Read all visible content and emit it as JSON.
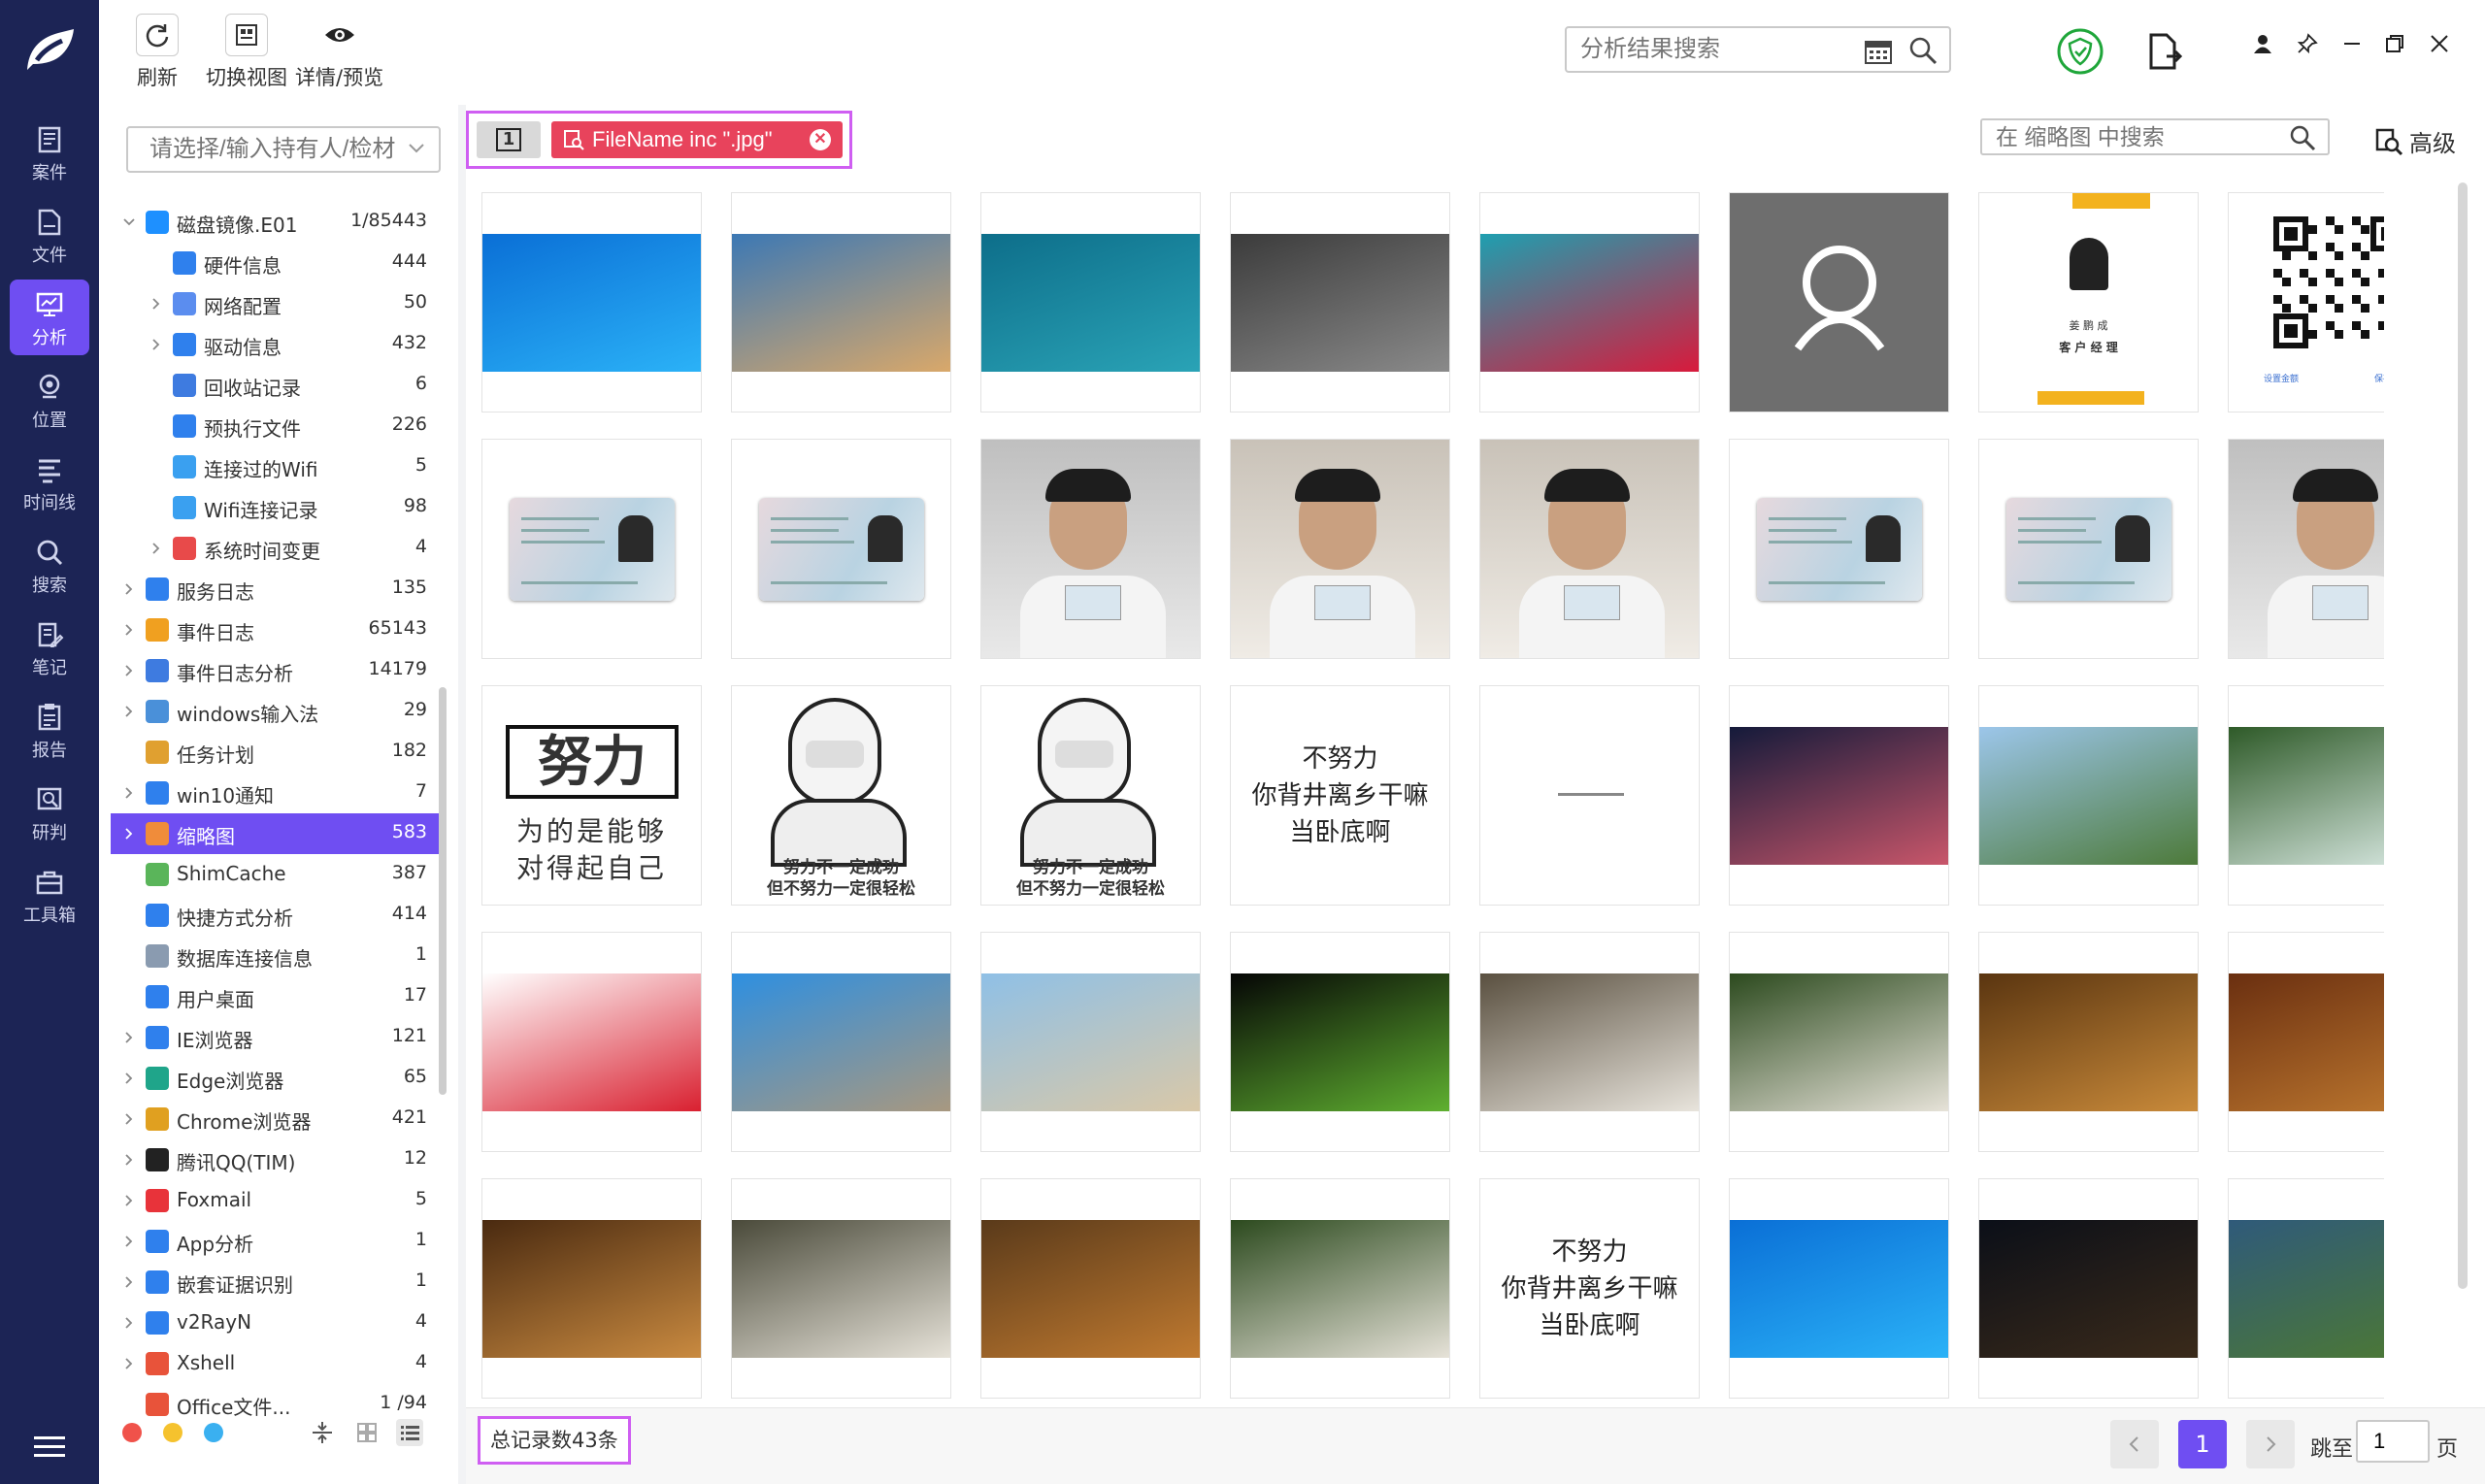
{
  "nav": {
    "items": [
      {
        "label": "案件",
        "icon": "case-icon"
      },
      {
        "label": "文件",
        "icon": "file-icon"
      },
      {
        "label": "分析",
        "icon": "analysis-icon",
        "active": true
      },
      {
        "label": "位置",
        "icon": "location-icon"
      },
      {
        "label": "时间线",
        "icon": "timeline-icon"
      },
      {
        "label": "搜索",
        "icon": "search-icon"
      },
      {
        "label": "笔记",
        "icon": "note-icon"
      },
      {
        "label": "报告",
        "icon": "report-icon"
      },
      {
        "label": "研判",
        "icon": "judge-icon"
      },
      {
        "label": "工具箱",
        "icon": "toolbox-icon"
      }
    ]
  },
  "toolbar": {
    "refresh": "刷新",
    "switch_view": "切换视图",
    "details": "详情/预览",
    "search_placeholder": "分析结果搜索"
  },
  "tree": {
    "filter_placeholder": "请选择/输入持有人/检材",
    "rows": [
      {
        "label": "磁盘镜像.E01",
        "count": "1/85443",
        "level": 0,
        "expand": "open",
        "icon_color": "#1e90ff"
      },
      {
        "label": "硬件信息",
        "count": "444",
        "level": 1,
        "expand": "none",
        "icon_color": "#2f80ed"
      },
      {
        "label": "网络配置",
        "count": "50",
        "level": 1,
        "expand": "closed",
        "icon_color": "#5b8def"
      },
      {
        "label": "驱动信息",
        "count": "432",
        "level": 1,
        "expand": "closed",
        "icon_color": "#2f80ed"
      },
      {
        "label": "回收站记录",
        "count": "6",
        "level": 1,
        "expand": "none",
        "icon_color": "#3e7be0"
      },
      {
        "label": "预执行文件",
        "count": "226",
        "level": 1,
        "expand": "none",
        "icon_color": "#2f80ed"
      },
      {
        "label": "连接过的Wifi",
        "count": "5",
        "level": 1,
        "expand": "none",
        "icon_color": "#3aa0f0"
      },
      {
        "label": "Wifi连接记录",
        "count": "98",
        "level": 1,
        "expand": "none",
        "icon_color": "#3aa0f0"
      },
      {
        "label": "系统时间变更",
        "count": "4",
        "level": 1,
        "expand": "closed",
        "icon_color": "#e84a4a"
      },
      {
        "label": "服务日志",
        "count": "135",
        "level": 0,
        "expand": "closed",
        "icon_color": "#2f80ed"
      },
      {
        "label": "事件日志",
        "count": "65143",
        "level": 0,
        "expand": "closed",
        "icon_color": "#f0a020"
      },
      {
        "label": "事件日志分析",
        "count": "14179",
        "level": 0,
        "expand": "closed",
        "icon_color": "#3e7be0"
      },
      {
        "label": "windows输入法",
        "count": "29",
        "level": 0,
        "expand": "closed",
        "icon_color": "#4a90d9"
      },
      {
        "label": "任务计划",
        "count": "182",
        "level": 0,
        "expand": "none",
        "icon_color": "#e0a030"
      },
      {
        "label": "win10通知",
        "count": "7",
        "level": 0,
        "expand": "closed",
        "icon_color": "#2f80ed"
      },
      {
        "label": "缩略图",
        "count": "583",
        "level": 0,
        "expand": "closed",
        "icon_color": "#f08c3a",
        "selected": true
      },
      {
        "label": "ShimCache",
        "count": "387",
        "level": 0,
        "expand": "none",
        "icon_color": "#5ab55a"
      },
      {
        "label": "快捷方式分析",
        "count": "414",
        "level": 0,
        "expand": "none",
        "icon_color": "#2f80ed"
      },
      {
        "label": "数据库连接信息",
        "count": "1",
        "level": 0,
        "expand": "none",
        "icon_color": "#8a9bb0"
      },
      {
        "label": "用户桌面",
        "count": "17",
        "level": 0,
        "expand": "none",
        "icon_color": "#2f80ed"
      },
      {
        "label": "IE浏览器",
        "count": "121",
        "level": 0,
        "expand": "closed",
        "icon_color": "#2f80ed"
      },
      {
        "label": "Edge浏览器",
        "count": "65",
        "level": 0,
        "expand": "closed",
        "icon_color": "#1fa58a"
      },
      {
        "label": "Chrome浏览器",
        "count": "421",
        "level": 0,
        "expand": "closed",
        "icon_color": "#e0a020"
      },
      {
        "label": "腾讯QQ(TIM)",
        "count": "12",
        "level": 0,
        "expand": "closed",
        "icon_color": "#222222"
      },
      {
        "label": "Foxmail",
        "count": "5",
        "level": 0,
        "expand": "closed",
        "icon_color": "#e8333a"
      },
      {
        "label": "App分析",
        "count": "1",
        "level": 0,
        "expand": "closed",
        "icon_color": "#2f80ed"
      },
      {
        "label": "嵌套证据识别",
        "count": "1",
        "level": 0,
        "expand": "closed",
        "icon_color": "#2f80ed"
      },
      {
        "label": "v2RayN",
        "count": "4",
        "level": 0,
        "expand": "closed",
        "icon_color": "#2f80ed"
      },
      {
        "label": "Xshell",
        "count": "4",
        "level": 0,
        "expand": "closed",
        "icon_color": "#e8533a"
      },
      {
        "label": "Office文件...",
        "count": "1  /94",
        "level": 0,
        "expand": "none",
        "icon_color": "#e8533a"
      }
    ]
  },
  "filter": {
    "tab_label": "1",
    "tag_label": "FileName inc \".jpg\""
  },
  "thumb_search": {
    "placeholder": "在 缩略图 中搜索"
  },
  "advanced_label": "高级",
  "thumbnails": [
    {
      "kind": "photo",
      "colors": [
        "#0a6fd6",
        "#2bb2f7"
      ],
      "desc": "windows-blue"
    },
    {
      "kind": "photo",
      "colors": [
        "#3c78b4",
        "#d9a86a"
      ],
      "desc": "beach-rock"
    },
    {
      "kind": "photo",
      "colors": [
        "#0d6e8a",
        "#2aa3b6"
      ],
      "desc": "underwater"
    },
    {
      "kind": "photo",
      "colors": [
        "#3b3b3b",
        "#8a8a8a"
      ],
      "desc": "rock-texture"
    },
    {
      "kind": "photo",
      "colors": [
        "#1e9fb0",
        "#d81a3c"
      ],
      "desc": "red-flower"
    },
    {
      "kind": "avatar",
      "colors": [
        "#6e6e6e",
        "#ffffff"
      ],
      "desc": "user-placeholder"
    },
    {
      "kind": "card",
      "colors": [
        "#ffffff",
        "#f3b21e"
      ],
      "desc": "business-card",
      "lines": [
        "姜 鹏 成",
        "客 户 经 理"
      ]
    },
    {
      "kind": "qr",
      "colors": [
        "#ffffff",
        "#111111"
      ],
      "desc": "qr-code",
      "lines": [
        "设置金额",
        "保存收款码"
      ]
    },
    {
      "kind": "idcard",
      "colors": [
        "#dfe8ee",
        "#b9d3e2"
      ],
      "desc": "id-card"
    },
    {
      "kind": "idcard",
      "colors": [
        "#dfe8ee",
        "#b9d3e2"
      ],
      "desc": "id-card"
    },
    {
      "kind": "person",
      "colors": [
        "#bfbfbf",
        "#e9e9e9"
      ],
      "desc": "man-holding-id"
    },
    {
      "kind": "person",
      "colors": [
        "#c9c2b8",
        "#f0ece6"
      ],
      "desc": "man-holding-id"
    },
    {
      "kind": "person",
      "colors": [
        "#c9c2b8",
        "#f0ece6"
      ],
      "desc": "man-holding-id"
    },
    {
      "kind": "idcard",
      "colors": [
        "#dfe8ee",
        "#b9d3e2"
      ],
      "desc": "id-card"
    },
    {
      "kind": "idcard",
      "colors": [
        "#dfe8ee",
        "#b9d3e2"
      ],
      "desc": "id-card"
    },
    {
      "kind": "person",
      "colors": [
        "#bfbfbf",
        "#e9e9e9"
      ],
      "desc": "man-holding-id"
    },
    {
      "kind": "calligraphy",
      "colors": [
        "#ffffff",
        "#111111"
      ],
      "desc": "meme-text",
      "lines": [
        "努力",
        "为的是能够",
        "对得起自己"
      ]
    },
    {
      "kind": "meme",
      "colors": [
        "#ffffff",
        "#222222"
      ],
      "desc": "meme-man",
      "lines": [
        "努力不一定成功",
        "但不努力一定很轻松"
      ]
    },
    {
      "kind": "meme",
      "colors": [
        "#ffffff",
        "#222222"
      ],
      "desc": "meme-man",
      "lines": [
        "努力不一定成功",
        "但不努力一定很轻松"
      ]
    },
    {
      "kind": "text",
      "colors": [
        "#ffffff",
        "#222222"
      ],
      "desc": "text-image",
      "lines": [
        "不努力",
        "你背井离乡干嘛",
        "当卧底啊"
      ]
    },
    {
      "kind": "tiny",
      "colors": [
        "#ffffff",
        "#888888"
      ],
      "desc": "blank-with-small-text"
    },
    {
      "kind": "photo",
      "colors": [
        "#141a3a",
        "#c8566a"
      ],
      "desc": "galaxy"
    },
    {
      "kind": "photo",
      "colors": [
        "#9cc6ea",
        "#4d7a3a"
      ],
      "desc": "pavilion-lake"
    },
    {
      "kind": "photo",
      "colors": [
        "#2e5a28",
        "#dfeee9"
      ],
      "desc": "waterfall"
    },
    {
      "kind": "photo",
      "colors": [
        "#ffffff",
        "#d92030"
      ],
      "desc": "strawberry"
    },
    {
      "kind": "photo",
      "colors": [
        "#2e8fe0",
        "#a89880"
      ],
      "desc": "goose"
    },
    {
      "kind": "photo",
      "colors": [
        "#8fc0e6",
        "#d9c8a8"
      ],
      "desc": "cartoon-dog"
    },
    {
      "kind": "photo",
      "colors": [
        "#050505",
        "#5fb030"
      ],
      "desc": "frog"
    },
    {
      "kind": "photo",
      "colors": [
        "#5a5040",
        "#e8e4dc"
      ],
      "desc": "white-tiger"
    },
    {
      "kind": "photo",
      "colors": [
        "#2c4a1e",
        "#e6e2d8"
      ],
      "desc": "white-tiger-grass"
    },
    {
      "kind": "photo",
      "colors": [
        "#5a3510",
        "#c98a3a"
      ],
      "desc": "lion"
    },
    {
      "kind": "photo",
      "colors": [
        "#6a2f10",
        "#c07a30"
      ],
      "desc": "lion"
    },
    {
      "kind": "photo",
      "colors": [
        "#4a2a10",
        "#c98a40"
      ],
      "desc": "lion"
    },
    {
      "kind": "photo",
      "colors": [
        "#4a4a3a",
        "#e6e2d8"
      ],
      "desc": "white-tiger"
    },
    {
      "kind": "photo",
      "colors": [
        "#5a3a1a",
        "#c07a30"
      ],
      "desc": "lion"
    },
    {
      "kind": "photo",
      "colors": [
        "#2c4a1e",
        "#e6e2d8"
      ],
      "desc": "white-tiger-grass"
    },
    {
      "kind": "text",
      "colors": [
        "#ffffff",
        "#222222"
      ],
      "desc": "text-image",
      "lines": [
        "不努力",
        "你背井离乡干嘛",
        "当卧底啊"
      ]
    },
    {
      "kind": "photo",
      "colors": [
        "#0a6fd6",
        "#2bb2f7"
      ],
      "desc": "windows-blue"
    },
    {
      "kind": "photo",
      "colors": [
        "#0b0f18",
        "#3a2a1a"
      ],
      "desc": "night-sky"
    },
    {
      "kind": "photo",
      "colors": [
        "#2f5a7a",
        "#4e7a30"
      ],
      "desc": "mountain-lake"
    }
  ],
  "footer": {
    "total": "总记录数43条",
    "current_page": "1",
    "jump_label": "跳至",
    "jump_value": "1",
    "page_suffix": "页"
  },
  "colors": {
    "nav_bg": "#1c2455",
    "accent": "#6f4ef2",
    "filter_tag": "#e8435c",
    "highlight_border": "#cf5ef2",
    "shield_green": "#1fa63a"
  }
}
